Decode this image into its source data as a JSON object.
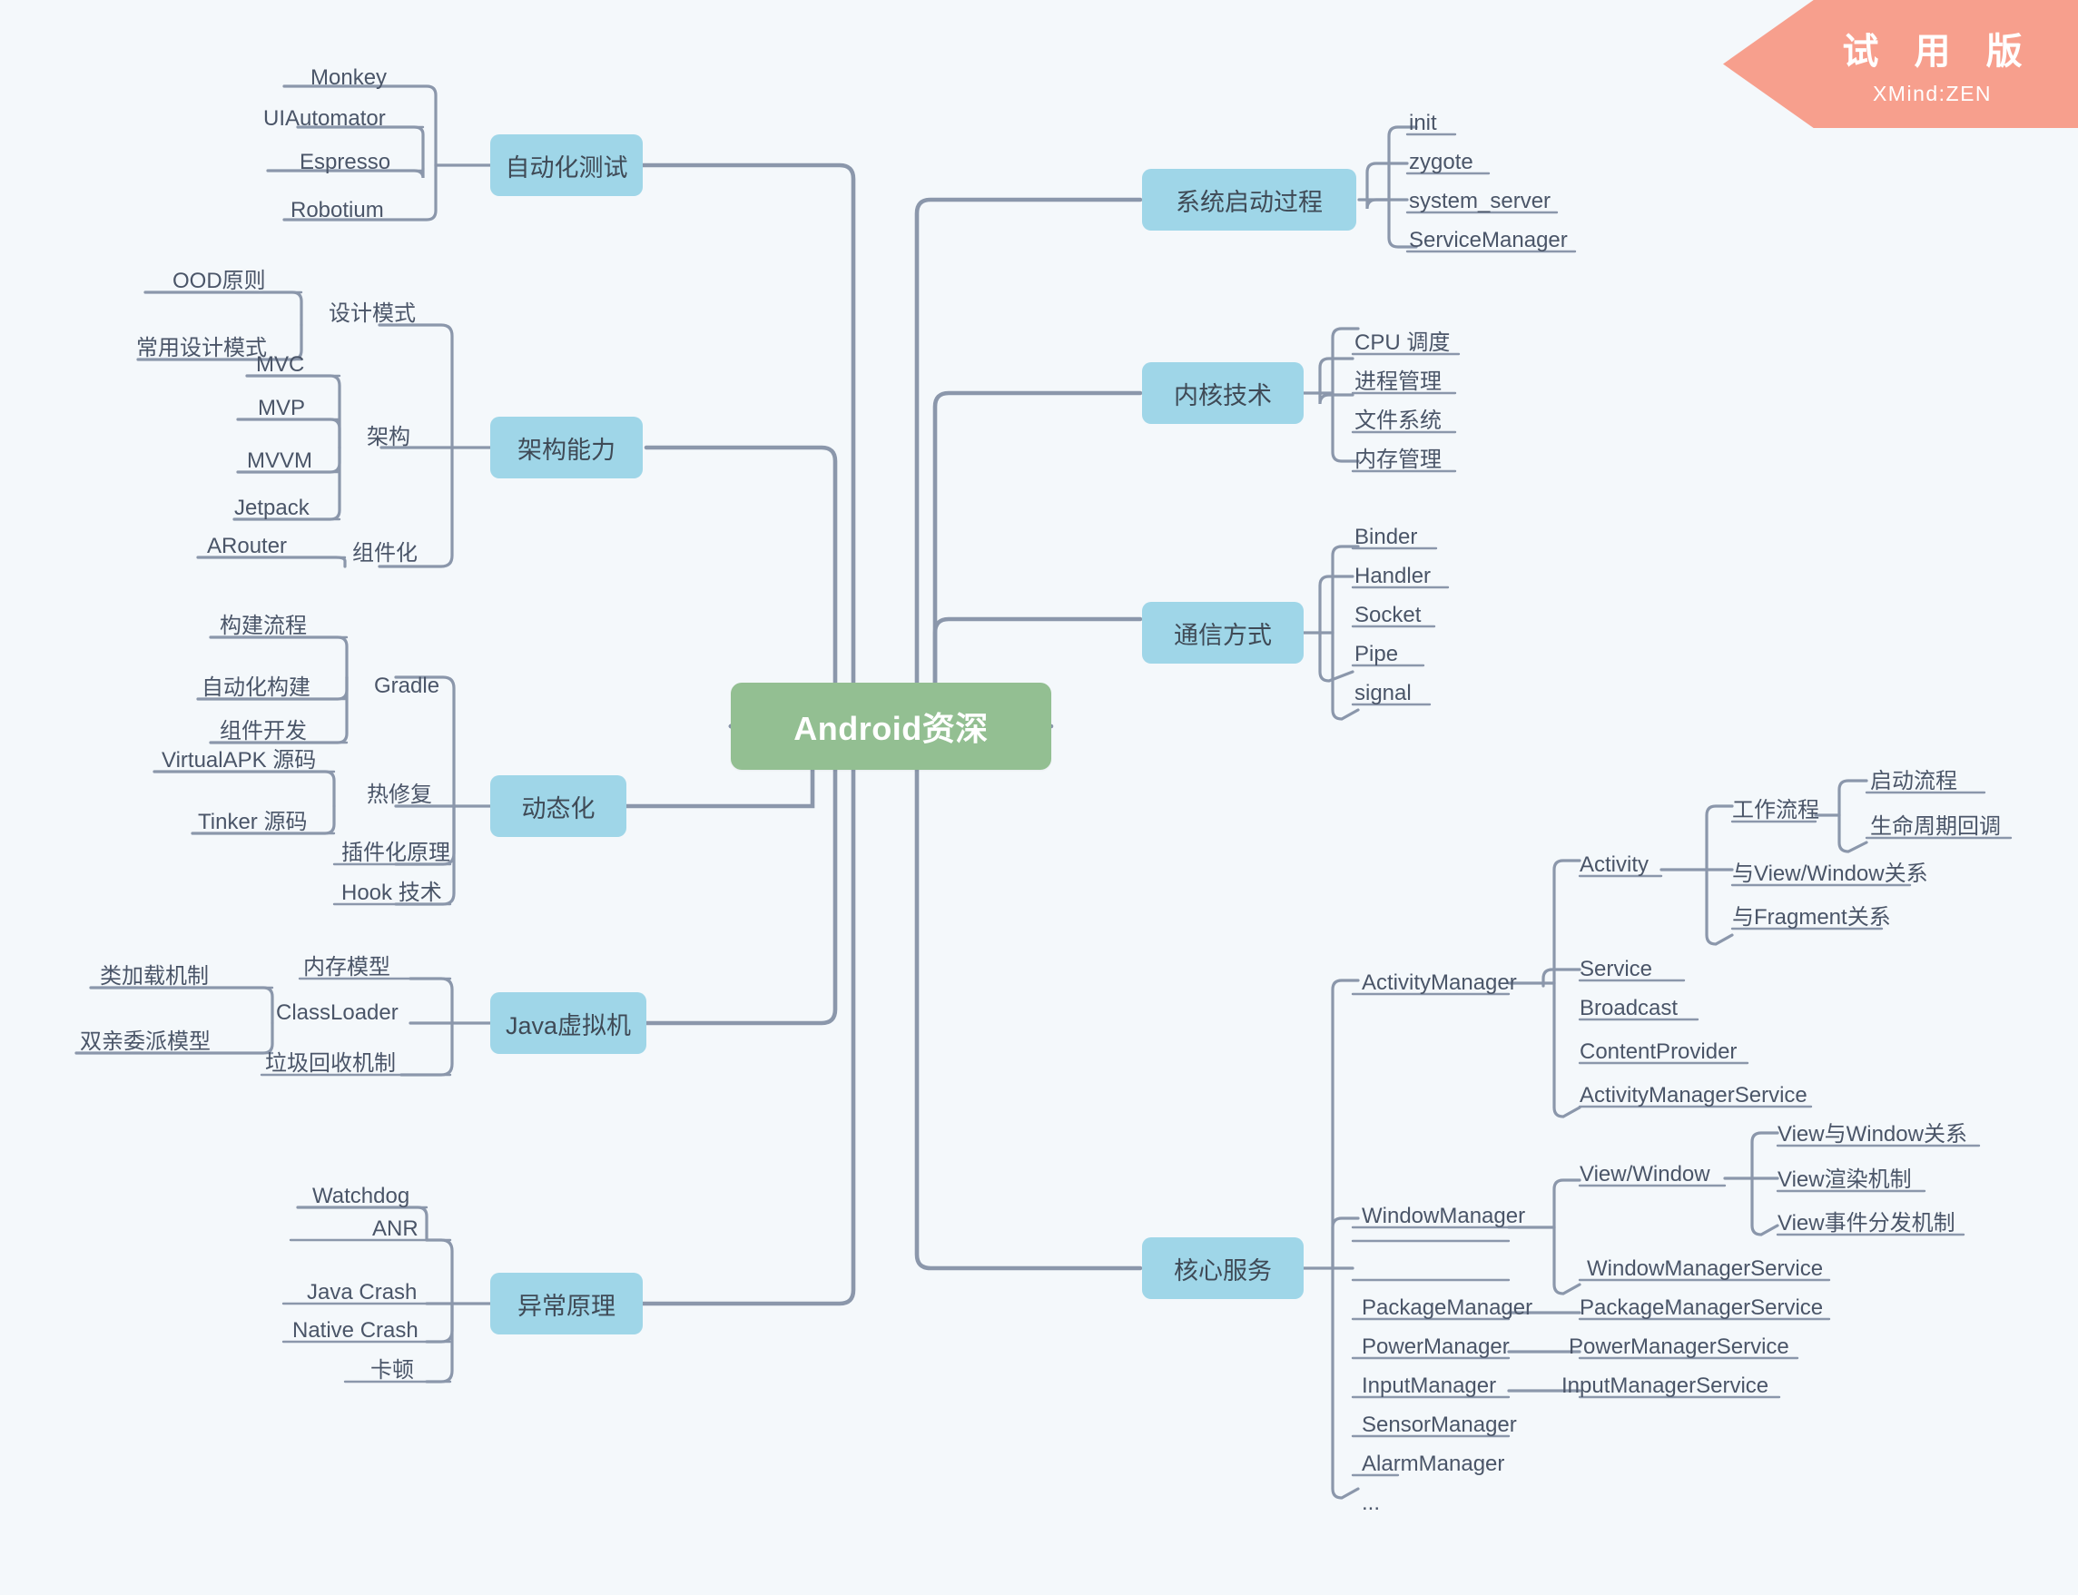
{
  "app": {
    "background_color": "#f4f8fb",
    "line_color": "#8b97ab",
    "root_color": "#93bf92",
    "branch_color": "#9fd6e8",
    "trial_color": "#f79f8d"
  },
  "trial_banner": {
    "title": "试 用 版",
    "product": "XMind:ZEN"
  },
  "root": {
    "label": "Android资深"
  },
  "branches_left": [
    {
      "label": "自动化测试",
      "children": [
        {
          "label": "Monkey"
        },
        {
          "label": "UIAutomator"
        },
        {
          "label": "Espresso"
        },
        {
          "label": "Robotium"
        }
      ]
    },
    {
      "label": "架构能力",
      "children": [
        {
          "label": "设计模式",
          "children": [
            {
              "label": "OOD原则"
            },
            {
              "label": "常用设计模式"
            }
          ]
        },
        {
          "label": "架构",
          "children": [
            {
              "label": "MVC"
            },
            {
              "label": "MVP"
            },
            {
              "label": "MVVM"
            },
            {
              "label": "Jetpack"
            }
          ]
        },
        {
          "label": "组件化",
          "children": [
            {
              "label": "ARouter"
            }
          ]
        }
      ]
    },
    {
      "label": "动态化",
      "children": [
        {
          "label": "Gradle",
          "children": [
            {
              "label": "构建流程"
            },
            {
              "label": "自动化构建"
            },
            {
              "label": "组件开发"
            }
          ]
        },
        {
          "label": "热修复",
          "children": [
            {
              "label": "VirtualAPK 源码"
            },
            {
              "label": "Tinker 源码"
            }
          ]
        },
        {
          "label": "插件化原理"
        },
        {
          "label": "Hook 技术"
        }
      ]
    },
    {
      "label": "Java虚拟机",
      "children": [
        {
          "label": "内存模型"
        },
        {
          "label": "ClassLoader",
          "children": [
            {
              "label": "类加载机制"
            },
            {
              "label": "双亲委派模型"
            }
          ]
        },
        {
          "label": "垃圾回收机制"
        }
      ]
    },
    {
      "label": "异常原理",
      "children": [
        {
          "label": "ANR",
          "children": [
            {
              "label": "Watchdog"
            }
          ]
        },
        {
          "label": "Java Crash"
        },
        {
          "label": "Native Crash"
        },
        {
          "label": "卡顿"
        }
      ]
    }
  ],
  "branches_right": [
    {
      "label": "系统启动过程",
      "children": [
        {
          "label": "init"
        },
        {
          "label": "zygote"
        },
        {
          "label": "system_server"
        },
        {
          "label": "ServiceManager"
        }
      ]
    },
    {
      "label": "内核技术",
      "children": [
        {
          "label": "CPU 调度"
        },
        {
          "label": "进程管理"
        },
        {
          "label": "文件系统"
        },
        {
          "label": "内存管理"
        }
      ]
    },
    {
      "label": "通信方式",
      "children": [
        {
          "label": "Binder"
        },
        {
          "label": "Handler"
        },
        {
          "label": "Socket"
        },
        {
          "label": "Pipe"
        },
        {
          "label": "signal"
        }
      ]
    },
    {
      "label": "核心服务",
      "children": [
        {
          "label": "ActivityManager",
          "children": [
            {
              "label": "Activity",
              "children": [
                {
                  "label": "工作流程",
                  "children": [
                    {
                      "label": "启动流程"
                    },
                    {
                      "label": "生命周期回调"
                    }
                  ]
                },
                {
                  "label": "与View/Window关系"
                },
                {
                  "label": "与Fragment关系"
                }
              ]
            },
            {
              "label": "Service"
            },
            {
              "label": "Broadcast"
            },
            {
              "label": "ContentProvider"
            },
            {
              "label": "ActivityManagerService"
            }
          ]
        },
        {
          "label": "WindowManager",
          "children": [
            {
              "label": "View/Window",
              "children": [
                {
                  "label": "View与Window关系"
                },
                {
                  "label": "View渲染机制"
                },
                {
                  "label": "View事件分发机制"
                }
              ]
            },
            {
              "label": "WindowManagerService"
            }
          ]
        },
        {
          "label": "PackageManager",
          "children": [
            {
              "label": "PackageManagerService"
            }
          ]
        },
        {
          "label": "PowerManager",
          "children": [
            {
              "label": "PowerManagerService"
            }
          ]
        },
        {
          "label": "InputManager",
          "children": [
            {
              "label": "InputManagerService"
            }
          ]
        },
        {
          "label": "SensorManager"
        },
        {
          "label": "AlarmManager"
        },
        {
          "label": "..."
        }
      ]
    }
  ]
}
